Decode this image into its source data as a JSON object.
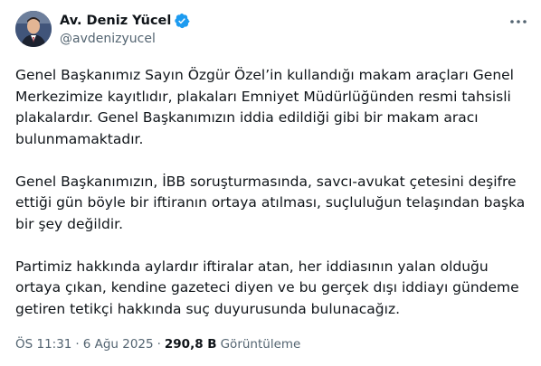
{
  "author": {
    "display_name": "Av. Deniz Yücel",
    "handle": "@avdenizyucel",
    "verified": true,
    "avatar_icon": "profile-photo"
  },
  "tweet": {
    "paragraphs": [
      "Genel Başkanımız Sayın Özgür Özel’in kullandığı makam araçları Genel Merkezimize kayıtlıdır, plakaları Emniyet Müdürlüğünden resmi tahsisli plakalardır. Genel Başkanımızın iddia edildiği gibi bir makam aracı bulunmamaktadır.",
      "Genel Başkanımızın, İBB soruşturmasında, savcı-avukat çetesini deşifre ettiği gün böyle bir iftiranın ortaya atılması, suçluluğun telaşından başka bir şey değildir.",
      "Partimiz hakkında aylardır iftiralar atan, her iddiasının yalan olduğu ortaya çıkan, kendine gazeteci diyen ve bu gerçek dışı iddiayı gündeme getiren tetikçi hakkında suç duyurusunda bulunacağız."
    ]
  },
  "meta": {
    "time": "ÖS 11:31",
    "separator": "·",
    "date": "6 Ağu 2025",
    "views_count": "290,8 B",
    "views_label": "Görüntüleme"
  },
  "colors": {
    "text_primary": "#0f1419",
    "text_secondary": "#536471",
    "verified_blue": "#1d9bf0"
  },
  "icons": {
    "more": "more-horizontal-icon",
    "verified": "verified-badge-icon"
  }
}
